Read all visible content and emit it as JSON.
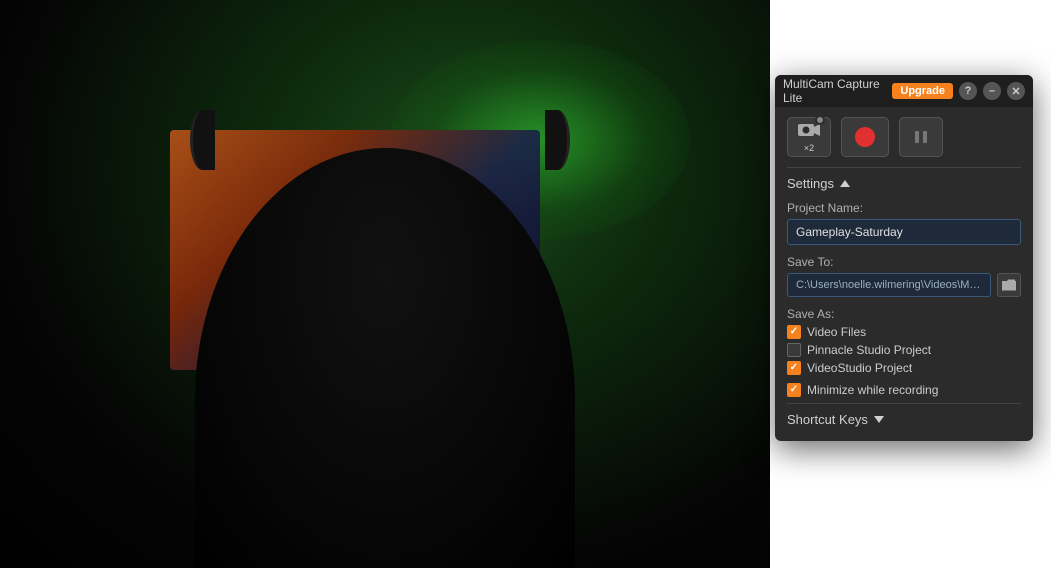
{
  "app": {
    "title": "MultiCam Capture Lite",
    "upgrade_label": "Upgrade",
    "help_icon": "?",
    "minimize_icon": "–",
    "close_icon": "✕"
  },
  "toolbar": {
    "settings_icon": "⚙",
    "record_label": "Record",
    "pause_label": "Pause",
    "speed_label": "×2"
  },
  "settings": {
    "header_label": "Settings",
    "project_name_label": "Project Name:",
    "project_name_value": "Gameplay-Saturday",
    "save_to_label": "Save To:",
    "save_to_path": "C:\\Users\\noelle.wilmering\\Videos\\Multi...",
    "save_as_label": "Save As:",
    "video_files_label": "Video Files",
    "video_files_checked": true,
    "pinnacle_studio_label": "Pinnacle Studio Project",
    "pinnacle_studio_checked": false,
    "videostudio_label": "VideoStudio Project",
    "videostudio_checked": true,
    "minimize_label": "Minimize while recording",
    "minimize_checked": true,
    "shortcut_keys_label": "Shortcut Keys"
  }
}
